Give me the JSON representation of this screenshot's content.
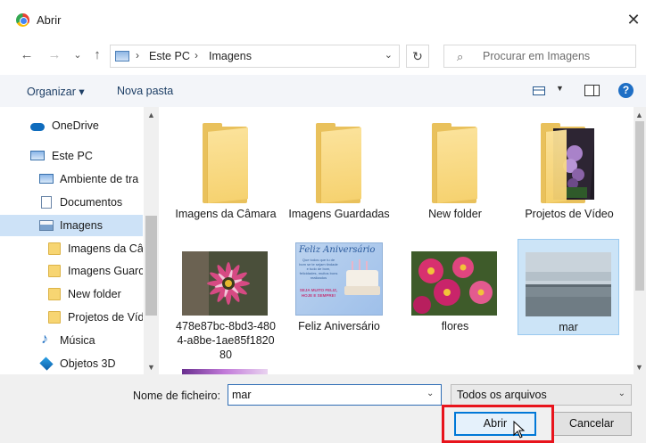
{
  "window": {
    "title": "Abrir",
    "close_glyph": "✕"
  },
  "nav": {
    "back_glyph": "←",
    "forward_glyph": "→",
    "history_glyph": "⌄",
    "up_glyph": "↑",
    "breadcrumb": [
      "Este PC",
      "Imagens"
    ],
    "separator": "›",
    "dropdown_glyph": "⌄",
    "refresh_glyph": "↻",
    "search_placeholder": "Procurar em Imagens",
    "search_glyph": "⌕"
  },
  "toolbar": {
    "organize_label": "Organizar ▾",
    "new_folder_label": "Nova pasta",
    "view_dropdown_glyph": "▼",
    "help_glyph": "?"
  },
  "sidebar": {
    "items": [
      {
        "label": "OneDrive",
        "icon": "cloud-icon"
      },
      {
        "label": "Este PC",
        "icon": "pc-icon"
      },
      {
        "label": "Ambiente de tra",
        "icon": "desktop-icon"
      },
      {
        "label": "Documentos",
        "icon": "documents-icon"
      },
      {
        "label": "Imagens",
        "icon": "pictures-icon",
        "selected": true
      },
      {
        "label": "Imagens da Câ",
        "icon": "folder-icon"
      },
      {
        "label": "Imagens Guarc",
        "icon": "folder-icon"
      },
      {
        "label": "New folder",
        "icon": "folder-icon"
      },
      {
        "label": "Projetos de Víd",
        "icon": "folder-icon"
      },
      {
        "label": "Música",
        "icon": "music-icon"
      },
      {
        "label": "Objetos 3D",
        "icon": "objects3d-icon"
      }
    ],
    "scroll_up_glyph": "▲",
    "scroll_down_glyph": "▼"
  },
  "files": [
    {
      "label": "Imagens da Câmara",
      "kind": "folder"
    },
    {
      "label": "Imagens Guardadas",
      "kind": "folder"
    },
    {
      "label": "New folder",
      "kind": "folder"
    },
    {
      "label": "Projetos de Vídeo",
      "kind": "folder-with-photo"
    },
    {
      "label": "478e87bc-8bd3-4804-a8be-1ae85f182080",
      "kind": "image"
    },
    {
      "label": "Feliz Aniversário",
      "kind": "image",
      "thumb_title": "Feliz Aniversário",
      "thumb_text": "Que todos que tu de bom se te sejam tindade e tudo de bom, felicidades, muitos bons realizados",
      "thumb_tagline": "SEJA MUITO FELIZ, HOJE E SEMPRE!"
    },
    {
      "label": "flores",
      "kind": "image"
    },
    {
      "label": "mar",
      "kind": "image",
      "selected": true
    }
  ],
  "footer": {
    "filename_label": "Nome de ficheiro:",
    "filename_value": "mar",
    "filter_label": "Todos os arquivos",
    "dropdown_glyph": "⌄",
    "open_button": "Abrir",
    "cancel_button": "Cancelar"
  },
  "colors": {
    "accent": "#0078d7",
    "highlight": "#e8141c",
    "selection": "#cce4f7"
  }
}
